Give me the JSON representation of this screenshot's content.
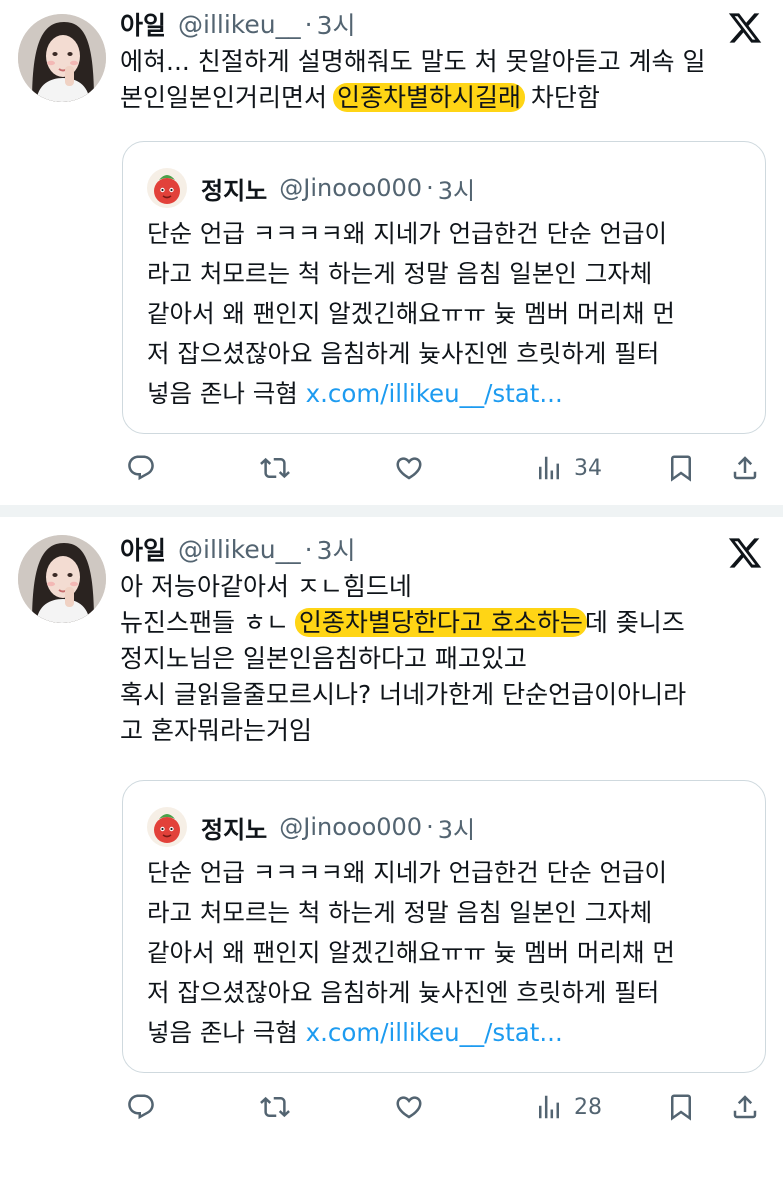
{
  "tweets": [
    {
      "author_name": "아일",
      "author_handle": "@illikeu__",
      "separator": "·",
      "time": "3시",
      "lines": [
        {
          "before": "에혀... 친절하게 설명해줘도 말도 처 못알아듣고 계속 일",
          "highlight": "",
          "after": ""
        },
        {
          "before": "본인일본인거리면서 ",
          "highlight": "인종차별하시길래",
          "after": " 차단함"
        }
      ],
      "quote": {
        "author_name": "정지노",
        "author_handle": "@Jinooo000",
        "separator": "·",
        "time": "3시",
        "lines": [
          "단순 언급 ㅋㅋㅋㅋ왜 지네가 언급한건 단순 언급이",
          "라고 처모르는 척 하는게 정말 음침 일본인 그자체",
          "같아서 왜 팬인지 알겠긴해요ㅠㅠ 늊 멤버 머리채 먼",
          "저 잡으셨잖아요 음침하게 늊사진엔 흐릿하게 필터"
        ],
        "last_line_text": "넣음 존나 극혐 ",
        "link": "x.com/illikeu__/stat..."
      },
      "views_count": "34"
    },
    {
      "author_name": "아일",
      "author_handle": "@illikeu__",
      "separator": "·",
      "time": "3시",
      "lines": [
        {
          "before": "아 저능아같아서 ㅈㄴ힘드네",
          "highlight": "",
          "after": ""
        },
        {
          "before": "뉴진스팬들 ㅎㄴ ",
          "highlight": "인종차별당한다고 호소하는",
          "after": "데 좆니즈"
        },
        {
          "before": "정지노님은 일본인음침하다고 패고있고",
          "highlight": "",
          "after": ""
        },
        {
          "before": "혹시 글읽을줄모르시나? 너네가한게 단순언급이아니라",
          "highlight": "",
          "after": ""
        },
        {
          "before": "고 혼자뭐라는거임",
          "highlight": "",
          "after": ""
        }
      ],
      "quote": {
        "author_name": "정지노",
        "author_handle": "@Jinooo000",
        "separator": "·",
        "time": "3시",
        "lines": [
          "단순 언급 ㅋㅋㅋㅋ왜 지네가 언급한건 단순 언급이",
          "라고 처모르는 척 하는게 정말 음침 일본인 그자체",
          "같아서 왜 팬인지 알겠긴해요ㅠㅠ 늊 멤버 머리채 먼",
          "저 잡으셨잖아요 음침하게 늊사진엔 흐릿하게 필터"
        ],
        "last_line_text": "넣음 존나 극혐 ",
        "link": "x.com/illikeu__/stat..."
      },
      "views_count": "28"
    }
  ],
  "icons": {
    "brand": "x-logo-icon",
    "reply": "reply-icon",
    "retweet": "retweet-icon",
    "like": "heart-icon",
    "views": "views-icon",
    "bookmark": "bookmark-icon",
    "share": "share-icon"
  },
  "colors": {
    "text": "#0f1419",
    "secondary": "#536471",
    "link": "#1d9bf0",
    "highlight": "#ffd515",
    "border": "#cfd9de",
    "separator_band": "#eff3f4"
  }
}
